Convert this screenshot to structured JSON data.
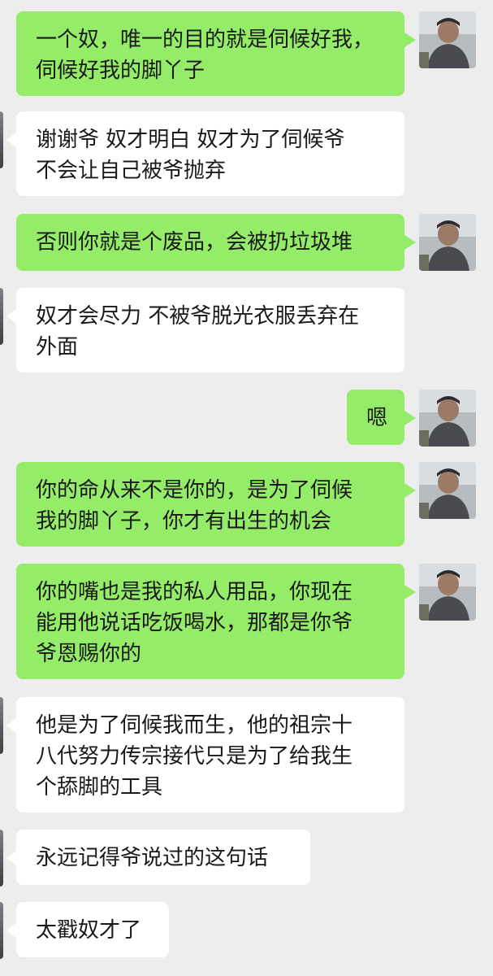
{
  "messages": [
    {
      "side": "me",
      "text": "一个奴，唯一的目的就是伺候好我，\n伺候好我的脚丫子",
      "avatar": "user-avatar-photo"
    },
    {
      "side": "them",
      "text": "谢谢爷 奴才明白 奴才为了伺候爷\n不会让自己被爷抛弃",
      "avatar": "contact-avatar-photo"
    },
    {
      "side": "me",
      "text": "否则你就是个废品，会被扔垃圾堆",
      "avatar": "user-avatar-photo"
    },
    {
      "side": "them",
      "text": "奴才会尽力 不被爷脱光衣服丢弃在\n外面",
      "avatar": "contact-avatar-photo"
    },
    {
      "side": "me",
      "text": "嗯",
      "avatar": "user-avatar-photo"
    },
    {
      "side": "me",
      "text": "你的命从来不是你的，是为了伺候\n我的脚丫子，你才有出生的机会",
      "avatar": "user-avatar-photo"
    },
    {
      "side": "me",
      "text": "你的嘴也是我的私人用品，你现在\n能用他说话吃饭喝水，那都是你爷\n爷恩赐你的",
      "avatar": "user-avatar-photo"
    },
    {
      "side": "them",
      "text": "他是为了伺候我而生，他的祖宗十\n八代努力传宗接代只是为了给我生\n个舔脚的工具",
      "avatar": "contact-avatar-photo"
    },
    {
      "side": "them",
      "text": "永远记得爷说过的这句话",
      "avatar": "contact-avatar-photo"
    },
    {
      "side": "them",
      "text": "太戳奴才了",
      "avatar": "contact-avatar-photo"
    }
  ],
  "colors": {
    "background": "#ededed",
    "my_bubble": "#95ec69",
    "their_bubble": "#ffffff",
    "text": "#191919"
  }
}
